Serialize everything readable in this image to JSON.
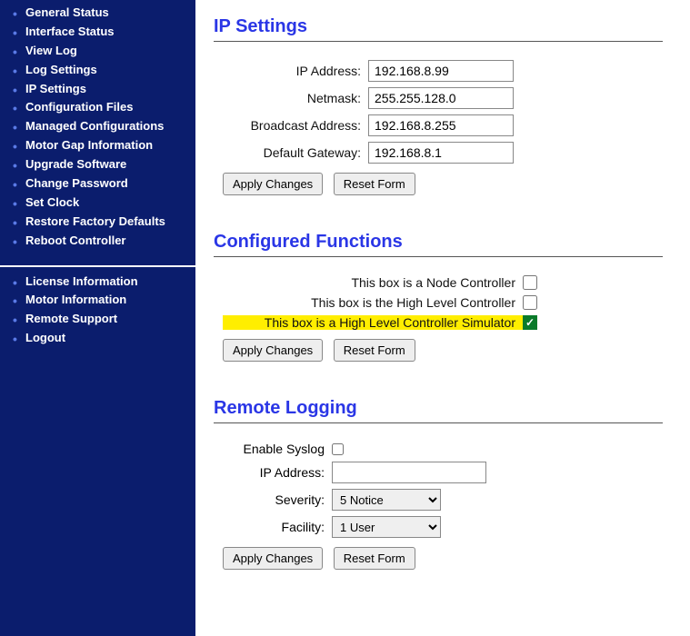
{
  "sidebar": {
    "group1": [
      "General Status",
      "Interface Status",
      "View Log",
      "Log Settings",
      "IP Settings",
      "Configuration Files",
      "Managed Configurations",
      "Motor Gap Information",
      "Upgrade Software",
      "Change Password",
      "Set Clock",
      "Restore Factory Defaults",
      "Reboot Controller"
    ],
    "group2": [
      "License Information",
      "Motor Information",
      "Remote Support",
      "Logout"
    ]
  },
  "ip_settings": {
    "heading": "IP Settings",
    "ip_address_label": "IP Address:",
    "ip_address_value": "192.168.8.99",
    "netmask_label": "Netmask:",
    "netmask_value": "255.255.128.0",
    "broadcast_label": "Broadcast Address:",
    "broadcast_value": "192.168.8.255",
    "gateway_label": "Default Gateway:",
    "gateway_value": "192.168.8.1",
    "apply_label": "Apply Changes",
    "reset_label": "Reset Form"
  },
  "configured_functions": {
    "heading": "Configured Functions",
    "node_controller_label": "This box is a Node Controller",
    "node_controller_checked": false,
    "high_level_label": "This box is the High Level Controller",
    "high_level_checked": false,
    "simulator_label": "This box is a High Level Controller Simulator",
    "simulator_checked": true,
    "apply_label": "Apply Changes",
    "reset_label": "Reset Form"
  },
  "remote_logging": {
    "heading": "Remote Logging",
    "enable_label": "Enable Syslog",
    "enable_checked": false,
    "ip_label": "IP Address:",
    "ip_value": "",
    "severity_label": "Severity:",
    "severity_value": "5 Notice",
    "facility_label": "Facility:",
    "facility_value": "1 User",
    "apply_label": "Apply Changes",
    "reset_label": "Reset Form"
  }
}
